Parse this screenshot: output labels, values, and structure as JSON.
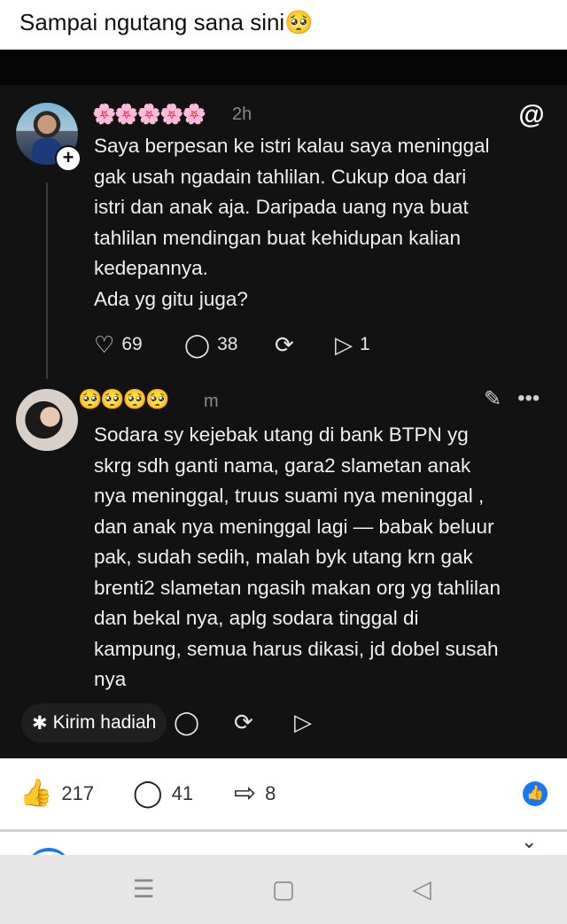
{
  "caption": "Sampai ngutang sana sini🥺",
  "post": {
    "author_emojis": "🌸🌸🌸🌸🌸",
    "time": "2h",
    "lines": [
      "Saya berpesan ke istri kalau saya meninggal",
      "gak usah ngadain tahlilan. Cukup doa dari",
      "istri dan anak aja. Daripada uang nya buat",
      "tahlilan mendingan buat kehidupan kalian",
      "kedepannya.",
      "Ada yg gitu juga?"
    ],
    "likes": "69",
    "replies": "38",
    "shares": "1"
  },
  "reply": {
    "author_emojis": "🥺🥺🥺🥺",
    "time": "m",
    "lines": [
      "Sodara sy kejebak utang di bank BTPN yg",
      "skrg sdh ganti nama, gara2 slametan anak",
      "nya meninggal, truus suami nya meninggal ,",
      "dan anak nya meninggal lagi — babak beluur",
      "pak, sudah sedih, malah byk utang krn gak",
      "brenti2 slametan ngasih makan org yg tahlilan",
      "dan bekal nya, aplg sodara tinggal di",
      "kampung, semua harus dikasi, jd dobel susah",
      "nya"
    ]
  },
  "gift_label": "Kirim hadiah",
  "fb": {
    "likes": "217",
    "comments": "41",
    "shares": "8"
  },
  "icons": {
    "plus": "+",
    "threads_logo": "@",
    "heart": "♡",
    "comment": "◯",
    "repost": "⟳",
    "send": "▷",
    "pencil": "✎",
    "more": "•••",
    "gift": "✱",
    "fb_like": "👍",
    "fb_comment": "◯",
    "fb_share": "⇨",
    "fb_badge": "👍",
    "nav_menu": "☰",
    "nav_home": "▢",
    "nav_back": "◁"
  },
  "colors": {
    "panel_bg": "#121212",
    "fb_blue": "#1877f2"
  }
}
